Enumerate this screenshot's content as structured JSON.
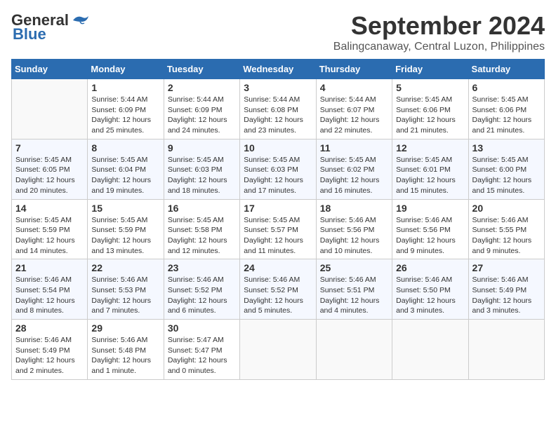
{
  "header": {
    "logo_general": "General",
    "logo_blue": "Blue",
    "month_title": "September 2024",
    "location": "Balingcanaway, Central Luzon, Philippines"
  },
  "weekdays": [
    "Sunday",
    "Monday",
    "Tuesday",
    "Wednesday",
    "Thursday",
    "Friday",
    "Saturday"
  ],
  "days": [
    {
      "num": "",
      "info": ""
    },
    {
      "num": "1",
      "info": "Sunrise: 5:44 AM\nSunset: 6:09 PM\nDaylight: 12 hours\nand 25 minutes."
    },
    {
      "num": "2",
      "info": "Sunrise: 5:44 AM\nSunset: 6:09 PM\nDaylight: 12 hours\nand 24 minutes."
    },
    {
      "num": "3",
      "info": "Sunrise: 5:44 AM\nSunset: 6:08 PM\nDaylight: 12 hours\nand 23 minutes."
    },
    {
      "num": "4",
      "info": "Sunrise: 5:44 AM\nSunset: 6:07 PM\nDaylight: 12 hours\nand 22 minutes."
    },
    {
      "num": "5",
      "info": "Sunrise: 5:45 AM\nSunset: 6:06 PM\nDaylight: 12 hours\nand 21 minutes."
    },
    {
      "num": "6",
      "info": "Sunrise: 5:45 AM\nSunset: 6:06 PM\nDaylight: 12 hours\nand 21 minutes."
    },
    {
      "num": "7",
      "info": "Sunrise: 5:45 AM\nSunset: 6:05 PM\nDaylight: 12 hours\nand 20 minutes."
    },
    {
      "num": "8",
      "info": "Sunrise: 5:45 AM\nSunset: 6:04 PM\nDaylight: 12 hours\nand 19 minutes."
    },
    {
      "num": "9",
      "info": "Sunrise: 5:45 AM\nSunset: 6:03 PM\nDaylight: 12 hours\nand 18 minutes."
    },
    {
      "num": "10",
      "info": "Sunrise: 5:45 AM\nSunset: 6:03 PM\nDaylight: 12 hours\nand 17 minutes."
    },
    {
      "num": "11",
      "info": "Sunrise: 5:45 AM\nSunset: 6:02 PM\nDaylight: 12 hours\nand 16 minutes."
    },
    {
      "num": "12",
      "info": "Sunrise: 5:45 AM\nSunset: 6:01 PM\nDaylight: 12 hours\nand 15 minutes."
    },
    {
      "num": "13",
      "info": "Sunrise: 5:45 AM\nSunset: 6:00 PM\nDaylight: 12 hours\nand 15 minutes."
    },
    {
      "num": "14",
      "info": "Sunrise: 5:45 AM\nSunset: 5:59 PM\nDaylight: 12 hours\nand 14 minutes."
    },
    {
      "num": "15",
      "info": "Sunrise: 5:45 AM\nSunset: 5:59 PM\nDaylight: 12 hours\nand 13 minutes."
    },
    {
      "num": "16",
      "info": "Sunrise: 5:45 AM\nSunset: 5:58 PM\nDaylight: 12 hours\nand 12 minutes."
    },
    {
      "num": "17",
      "info": "Sunrise: 5:45 AM\nSunset: 5:57 PM\nDaylight: 12 hours\nand 11 minutes."
    },
    {
      "num": "18",
      "info": "Sunrise: 5:46 AM\nSunset: 5:56 PM\nDaylight: 12 hours\nand 10 minutes."
    },
    {
      "num": "19",
      "info": "Sunrise: 5:46 AM\nSunset: 5:56 PM\nDaylight: 12 hours\nand 9 minutes."
    },
    {
      "num": "20",
      "info": "Sunrise: 5:46 AM\nSunset: 5:55 PM\nDaylight: 12 hours\nand 9 minutes."
    },
    {
      "num": "21",
      "info": "Sunrise: 5:46 AM\nSunset: 5:54 PM\nDaylight: 12 hours\nand 8 minutes."
    },
    {
      "num": "22",
      "info": "Sunrise: 5:46 AM\nSunset: 5:53 PM\nDaylight: 12 hours\nand 7 minutes."
    },
    {
      "num": "23",
      "info": "Sunrise: 5:46 AM\nSunset: 5:52 PM\nDaylight: 12 hours\nand 6 minutes."
    },
    {
      "num": "24",
      "info": "Sunrise: 5:46 AM\nSunset: 5:52 PM\nDaylight: 12 hours\nand 5 minutes."
    },
    {
      "num": "25",
      "info": "Sunrise: 5:46 AM\nSunset: 5:51 PM\nDaylight: 12 hours\nand 4 minutes."
    },
    {
      "num": "26",
      "info": "Sunrise: 5:46 AM\nSunset: 5:50 PM\nDaylight: 12 hours\nand 3 minutes."
    },
    {
      "num": "27",
      "info": "Sunrise: 5:46 AM\nSunset: 5:49 PM\nDaylight: 12 hours\nand 3 minutes."
    },
    {
      "num": "28",
      "info": "Sunrise: 5:46 AM\nSunset: 5:49 PM\nDaylight: 12 hours\nand 2 minutes."
    },
    {
      "num": "29",
      "info": "Sunrise: 5:46 AM\nSunset: 5:48 PM\nDaylight: 12 hours\nand 1 minute."
    },
    {
      "num": "30",
      "info": "Sunrise: 5:47 AM\nSunset: 5:47 PM\nDaylight: 12 hours\nand 0 minutes."
    },
    {
      "num": "",
      "info": ""
    },
    {
      "num": "",
      "info": ""
    },
    {
      "num": "",
      "info": ""
    },
    {
      "num": "",
      "info": ""
    }
  ]
}
